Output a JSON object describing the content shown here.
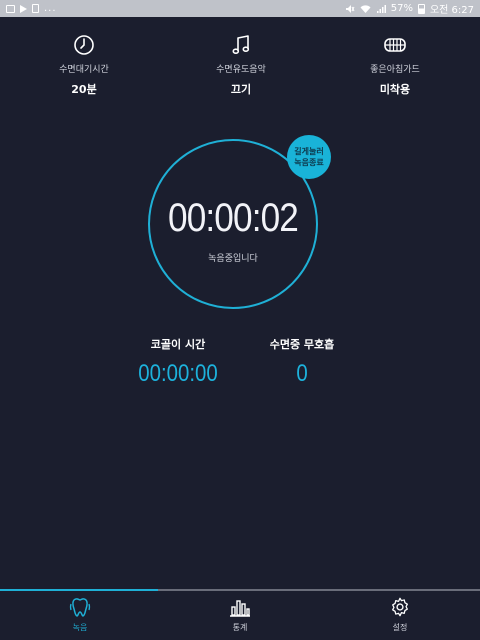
{
  "statusbar": {
    "left_icons": [
      "image-icon",
      "play-icon",
      "clipboard-icon"
    ],
    "left_more": "...",
    "right_icons": [
      "mute-icon",
      "wifi-icon",
      "signal-icon",
      "battery-icon"
    ],
    "battery": "57%",
    "time": "오전 6:27"
  },
  "options": [
    {
      "icon": "clock-icon",
      "label": "수면대기시간",
      "value": "20분"
    },
    {
      "icon": "music-note-icon",
      "label": "수면유도음악",
      "value": "끄기"
    },
    {
      "icon": "mouthguard-icon",
      "label": "좋은아침가드",
      "value": "미착용"
    }
  ],
  "recording": {
    "badge_line1": "길게눌러",
    "badge_line2": "녹음종료",
    "timer": "00:00:02",
    "status": "녹음중입니다"
  },
  "stats": {
    "snore_label": "코골이 시간",
    "snore_value": "00:00:00",
    "apnea_label": "수면중 무호흡",
    "apnea_value": "0"
  },
  "tabs": [
    {
      "icon": "tooth-record-icon",
      "label": "녹음",
      "active": true
    },
    {
      "icon": "bar-chart-icon",
      "label": "통계",
      "active": false
    },
    {
      "icon": "gear-icon",
      "label": "설정",
      "active": false
    }
  ],
  "colors": {
    "background": "#1b1e2e",
    "accent": "#1fb0d6",
    "statusbar": "#bfc2c9"
  }
}
